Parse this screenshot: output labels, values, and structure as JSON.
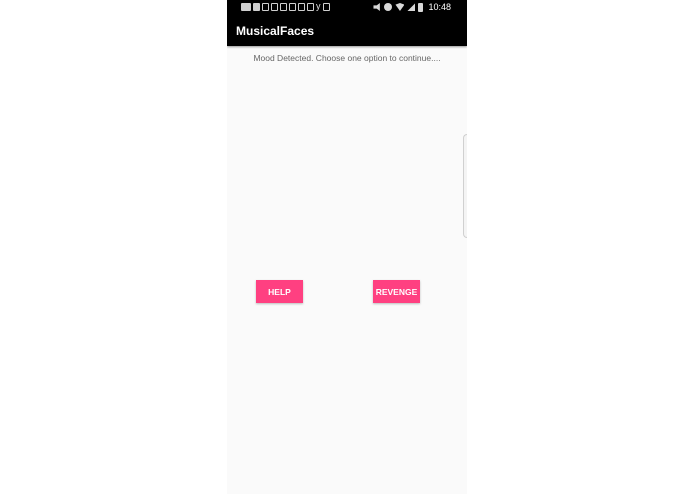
{
  "status_bar": {
    "time": "10:48",
    "carrier_glyph": "y",
    "notification_icons": [
      "voicemail-icon",
      "facebook-icon",
      "app-icon",
      "app-icon",
      "app-icon",
      "app-icon",
      "app-icon",
      "app-icon",
      "app-icon"
    ],
    "system_icons": [
      "mute-icon",
      "alarm-icon",
      "wifi-icon",
      "signal-icon",
      "battery-icon"
    ]
  },
  "app_bar": {
    "title": "MusicalFaces",
    "background": "#000000"
  },
  "main": {
    "message": "Mood Detected. Choose one option to continue....",
    "buttons": {
      "help": "HELP",
      "revenge": "REVENGE"
    },
    "accent_color": "#ff4081"
  }
}
